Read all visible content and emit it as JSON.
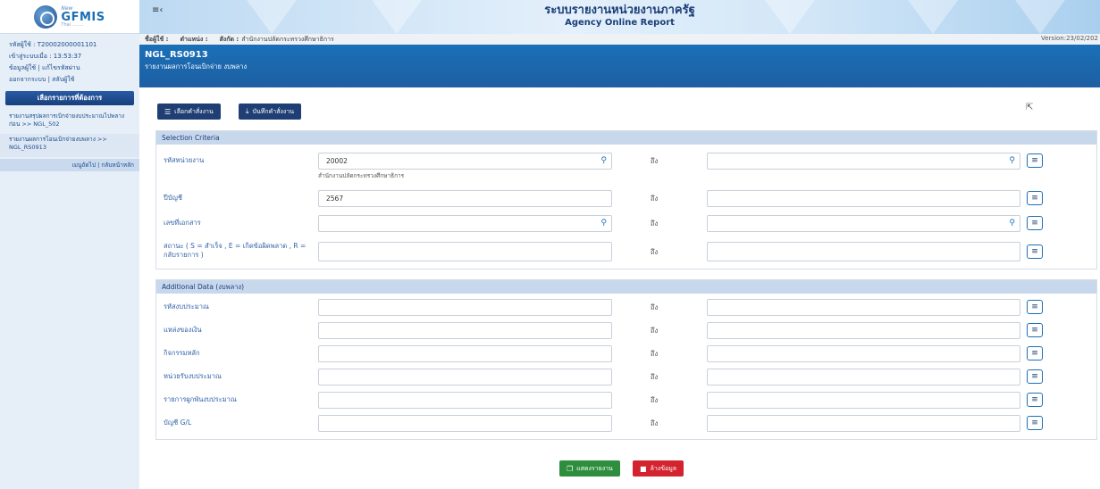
{
  "logo": {
    "new": "New",
    "main": "GFMIS",
    "sub": "Thai ........"
  },
  "sidebar": {
    "user_id": "รหัสผู้ใช้ : T20002000001101",
    "login_time": "เข้าสู่ระบบเมื่อ : 13:53:37",
    "profile_link": "ข้อมูลผู้ใช้",
    "password_link": "แก้ไขรหัสผ่าน",
    "logout_link": "ออกจากระบบ",
    "switch_link": "สลับผู้ใช้",
    "menu_header": "เลือกรายการที่ต้องการ",
    "items": [
      {
        "label": "รายงานสรุปผลการเบิกจ่ายงบประมาณไปพลางก่อน >> NGL_502"
      },
      {
        "label": "รายงานผลการโอนเบิกจ่ายงบพลาง >> NGL_RS0913"
      }
    ],
    "prev_menu": "เมนูถัดไป",
    "home_link": "กลับหน้าหลัก"
  },
  "banner": {
    "title_th": "ระบบรายงานหน่วยงานภาครัฐ",
    "title_en": "Agency Online Report",
    "menu_icon": "hamburger-icon"
  },
  "infobar": {
    "user_label": "ชื่อผู้ใช้ :",
    "position_label": "ตำแหน่ง :",
    "org_label": "สังกัด :",
    "org_value": "สำนักงานปลัดกระทรวงศึกษาธิการ",
    "version": "Version:23/02/202"
  },
  "report": {
    "code": "NGL_RS0913",
    "name": "รายงานผลการโอนเบิกจ่าย งบพลาง"
  },
  "toolbar": {
    "select_order_label": "เลือกคำสั่งงาน",
    "save_order_label": "บันทึกคำสั่งงาน"
  },
  "selection": {
    "title": "Selection Criteria",
    "to_label": "ถึง",
    "agency_label": "รหัสหน่วยงาน",
    "agency_value": "20002",
    "agency_hint": "สำนักงานปลัดกระทรวงศึกษาธิการ",
    "fiscal_year_label": "ปีบัญชี",
    "fiscal_year_value": "2567",
    "doc_no_label": "เลขที่เอกสาร",
    "status_label": "สถานะ ( S = สำเร็จ , E = เกิดข้อผิดพลาด , R = กลับรายการ )"
  },
  "additional": {
    "title": "Additional Data (งบพลาง)",
    "rows": [
      {
        "label": "รหัสงบประมาณ"
      },
      {
        "label": "แหล่งของเงิน"
      },
      {
        "label": "กิจกรรมหลัก"
      },
      {
        "label": "หน่วยรับงบประมาณ"
      },
      {
        "label": "รายการผูกพันงบประมาณ"
      },
      {
        "label": "บัญชี G/L"
      }
    ]
  },
  "actions": {
    "show_report_label": "แสดงรายงาน",
    "clear_label": "ล้างข้อมูล"
  },
  "colors": {
    "title_bar": "#1a70b8",
    "section_header": "#c8d8ec",
    "label_blue": "#2d5fa6",
    "show_btn": "#2f8e3e",
    "clear_btn": "#d3232f",
    "toolbar_btn": "#1f3f74"
  }
}
